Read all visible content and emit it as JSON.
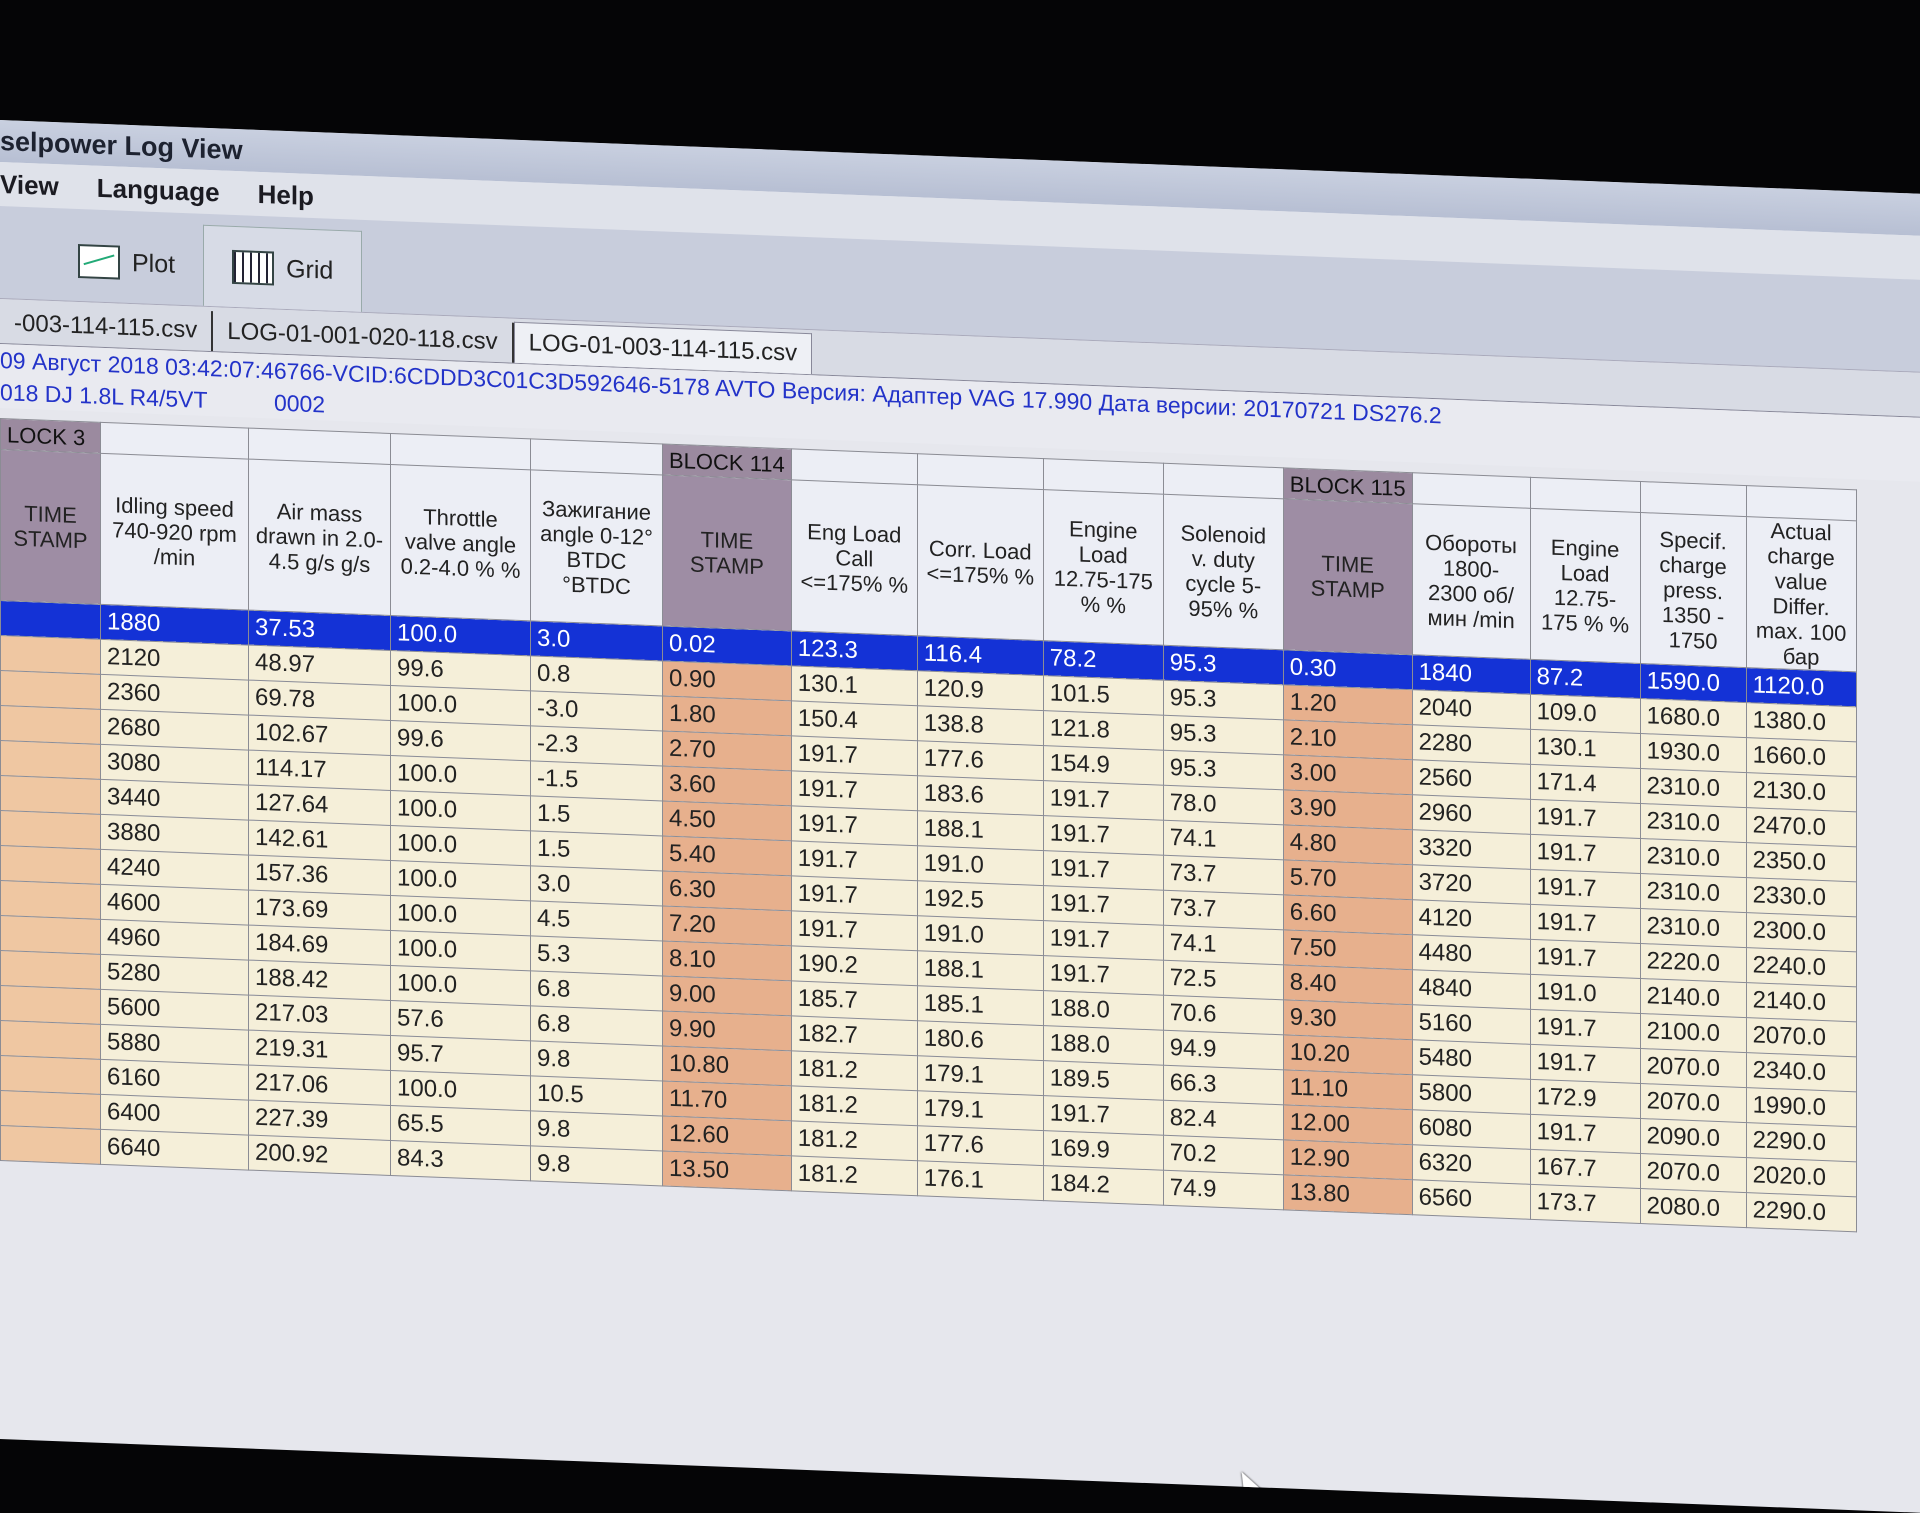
{
  "window": {
    "title": "selpower Log View"
  },
  "menu": [
    "View",
    "Language",
    "Help"
  ],
  "toolbar": {
    "plot_label": "Plot",
    "grid_label": "Grid"
  },
  "file_tabs": [
    "-003-114-115.csv",
    "LOG-01-001-020-118.csv",
    "LOG-01-003-114-115.csv"
  ],
  "info": {
    "line1": "09 Август 2018 03:42:07:46766-VCID:6CDDD3C01C3D592646-5178 AVTO Версия: Адаптер VAG 17.990 Дата версии: 20170721 DS276.2",
    "line2_a": "018 DJ  1.8L R4/5VT",
    "line2_b": "0002"
  },
  "blocks": {
    "b3": "LOCK 3",
    "b114": "BLOCK 114",
    "b115": "BLOCK 115"
  },
  "headers": [
    "TIME STAMP",
    "Idling speed 740-920 rpm /min",
    "Air mass drawn in 2.0-4.5 g/s g/s",
    "Throttle valve angle 0.2-4.0 % %",
    "Зажигание angle 0-12° BTDC °BTDC",
    "TIME STAMP",
    "Eng Load Call <=175% %",
    "Corr. Load <=175% %",
    "Engine Load 12.75-175 % %",
    "Solenoid v. duty cycle 5-95% %",
    "TIME STAMP",
    "Обороты 1800-2300 об/мин /min",
    "Engine Load 12.75-175 % %",
    "Specif. charge press. 1350 - 1750",
    "Actual charge value Differ. max. 100 бар"
  ],
  "rows": [
    [
      "",
      "1880",
      "37.53",
      "100.0",
      "3.0",
      "0.02",
      "123.3",
      "116.4",
      "78.2",
      "95.3",
      "0.30",
      "1840",
      "87.2",
      "1590.0",
      "1120.0"
    ],
    [
      "",
      "2120",
      "48.97",
      "99.6",
      "0.8",
      "0.90",
      "130.1",
      "120.9",
      "101.5",
      "95.3",
      "1.20",
      "2040",
      "109.0",
      "1680.0",
      "1380.0"
    ],
    [
      "",
      "2360",
      "69.78",
      "100.0",
      "-3.0",
      "1.80",
      "150.4",
      "138.8",
      "121.8",
      "95.3",
      "2.10",
      "2280",
      "130.1",
      "1930.0",
      "1660.0"
    ],
    [
      "",
      "2680",
      "102.67",
      "99.6",
      "-2.3",
      "2.70",
      "191.7",
      "177.6",
      "154.9",
      "95.3",
      "3.00",
      "2560",
      "171.4",
      "2310.0",
      "2130.0"
    ],
    [
      "",
      "3080",
      "114.17",
      "100.0",
      "-1.5",
      "3.60",
      "191.7",
      "183.6",
      "191.7",
      "78.0",
      "3.90",
      "2960",
      "191.7",
      "2310.0",
      "2470.0"
    ],
    [
      "",
      "3440",
      "127.64",
      "100.0",
      "1.5",
      "4.50",
      "191.7",
      "188.1",
      "191.7",
      "74.1",
      "4.80",
      "3320",
      "191.7",
      "2310.0",
      "2350.0"
    ],
    [
      "",
      "3880",
      "142.61",
      "100.0",
      "1.5",
      "5.40",
      "191.7",
      "191.0",
      "191.7",
      "73.7",
      "5.70",
      "3720",
      "191.7",
      "2310.0",
      "2330.0"
    ],
    [
      "",
      "4240",
      "157.36",
      "100.0",
      "3.0",
      "6.30",
      "191.7",
      "192.5",
      "191.7",
      "73.7",
      "6.60",
      "4120",
      "191.7",
      "2310.0",
      "2300.0"
    ],
    [
      "",
      "4600",
      "173.69",
      "100.0",
      "4.5",
      "7.20",
      "191.7",
      "191.0",
      "191.7",
      "74.1",
      "7.50",
      "4480",
      "191.7",
      "2220.0",
      "2240.0"
    ],
    [
      "",
      "4960",
      "184.69",
      "100.0",
      "5.3",
      "8.10",
      "190.2",
      "188.1",
      "191.7",
      "72.5",
      "8.40",
      "4840",
      "191.0",
      "2140.0",
      "2140.0"
    ],
    [
      "",
      "5280",
      "188.42",
      "100.0",
      "6.8",
      "9.00",
      "185.7",
      "185.1",
      "188.0",
      "70.6",
      "9.30",
      "5160",
      "191.7",
      "2100.0",
      "2070.0"
    ],
    [
      "",
      "5600",
      "217.03",
      "57.6",
      "6.8",
      "9.90",
      "182.7",
      "180.6",
      "188.0",
      "94.9",
      "10.20",
      "5480",
      "191.7",
      "2070.0",
      "2340.0"
    ],
    [
      "",
      "5880",
      "219.31",
      "95.7",
      "9.8",
      "10.80",
      "181.2",
      "179.1",
      "189.5",
      "66.3",
      "11.10",
      "5800",
      "172.9",
      "2070.0",
      "1990.0"
    ],
    [
      "",
      "6160",
      "217.06",
      "100.0",
      "10.5",
      "11.70",
      "181.2",
      "179.1",
      "191.7",
      "82.4",
      "12.00",
      "6080",
      "191.7",
      "2090.0",
      "2290.0"
    ],
    [
      "",
      "6400",
      "227.39",
      "65.5",
      "9.8",
      "12.60",
      "181.2",
      "177.6",
      "169.9",
      "70.2",
      "12.90",
      "6320",
      "167.7",
      "2070.0",
      "2020.0"
    ],
    [
      "",
      "6640",
      "200.92",
      "84.3",
      "9.8",
      "13.50",
      "181.2",
      "176.1",
      "184.2",
      "74.9",
      "13.80",
      "6560",
      "173.7",
      "2080.0",
      "2290.0"
    ]
  ]
}
